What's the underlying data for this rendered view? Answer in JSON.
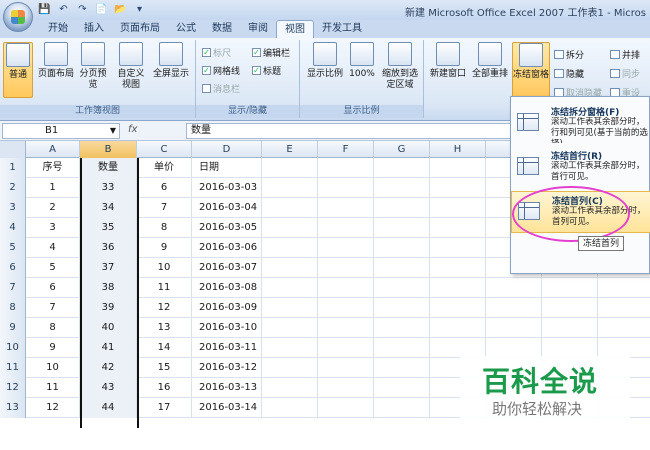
{
  "window": {
    "title": "新建 Microsoft Office Excel 2007 工作表1 - Micros"
  },
  "qat": [
    "💾",
    "↶",
    "↷",
    "📄",
    "📂",
    "▾"
  ],
  "tabs": [
    {
      "label": "开始",
      "active": false
    },
    {
      "label": "插入",
      "active": false
    },
    {
      "label": "页面布局",
      "active": false
    },
    {
      "label": "公式",
      "active": false
    },
    {
      "label": "数据",
      "active": false
    },
    {
      "label": "审阅",
      "active": false
    },
    {
      "label": "视图",
      "active": true
    },
    {
      "label": "开发工具",
      "active": false
    }
  ],
  "ribbon": {
    "workbook_views": {
      "label": "工作簿视图",
      "normal": "普通",
      "page_layout": "页面布局",
      "page_break": "分页预览",
      "custom": "自定义视图",
      "fullscreen": "全屏显示"
    },
    "show_hide": {
      "label": "显示/隐藏",
      "ruler": "标尺",
      "gridlines": "网格线",
      "message_bar": "消息栏",
      "formula_bar": "编辑栏",
      "headings": "标题"
    },
    "zoom": {
      "label": "显示比例",
      "zoom": "显示比例",
      "hundred": "100%",
      "to_selection": "缩放到选定区域"
    },
    "window": {
      "new_window": "新建窗口",
      "arrange_all": "全部重排",
      "freeze_panes": "冻结窗格",
      "split": "拆分",
      "hide": "隐藏",
      "unhide": "取消隐藏",
      "side_by_side": "并排",
      "sync": "同步",
      "reset": "重设"
    }
  },
  "formula_bar": {
    "cell_ref": "B1",
    "fx": "fx",
    "content": "数量"
  },
  "columns": [
    "A",
    "B",
    "C",
    "D",
    "E",
    "F",
    "G",
    "H"
  ],
  "rows": [
    {
      "n": "1",
      "a": "序号",
      "b": "数量",
      "c": "单价",
      "d": "日期"
    },
    {
      "n": "2",
      "a": "1",
      "b": "33",
      "c": "6",
      "d": "2016-03-03"
    },
    {
      "n": "3",
      "a": "2",
      "b": "34",
      "c": "7",
      "d": "2016-03-04"
    },
    {
      "n": "4",
      "a": "3",
      "b": "35",
      "c": "8",
      "d": "2016-03-05"
    },
    {
      "n": "5",
      "a": "4",
      "b": "36",
      "c": "9",
      "d": "2016-03-06"
    },
    {
      "n": "6",
      "a": "5",
      "b": "37",
      "c": "10",
      "d": "2016-03-07"
    },
    {
      "n": "7",
      "a": "6",
      "b": "38",
      "c": "11",
      "d": "2016-03-08"
    },
    {
      "n": "8",
      "a": "7",
      "b": "39",
      "c": "12",
      "d": "2016-03-09"
    },
    {
      "n": "9",
      "a": "8",
      "b": "40",
      "c": "13",
      "d": "2016-03-10"
    },
    {
      "n": "10",
      "a": "9",
      "b": "41",
      "c": "14",
      "d": "2016-03-11"
    },
    {
      "n": "11",
      "a": "10",
      "b": "42",
      "c": "15",
      "d": "2016-03-12"
    },
    {
      "n": "12",
      "a": "11",
      "b": "43",
      "c": "16",
      "d": "2016-03-13"
    },
    {
      "n": "13",
      "a": "12",
      "b": "44",
      "c": "17",
      "d": "2016-03-14"
    }
  ],
  "freeze_menu": [
    {
      "title": "冻结拆分窗格(F)",
      "desc": "滚动工作表其余部分时，行和列可见(基于当前的选择)"
    },
    {
      "title": "冻结首行(R)",
      "desc": "滚动工作表其余部分时，首行可见。"
    },
    {
      "title": "冻结首列(C)",
      "desc": "滚动工作表其余部分时，首列可见。"
    }
  ],
  "tooltip": "冻结首列",
  "watermark": {
    "main": "百科全说",
    "sub": "助你轻松解决"
  },
  "colors": {
    "accent": "#ffc85c",
    "ribbon": "#dbe7f5",
    "highlight_ellipse": "#e440d0",
    "watermark": "#1a9a4a"
  }
}
